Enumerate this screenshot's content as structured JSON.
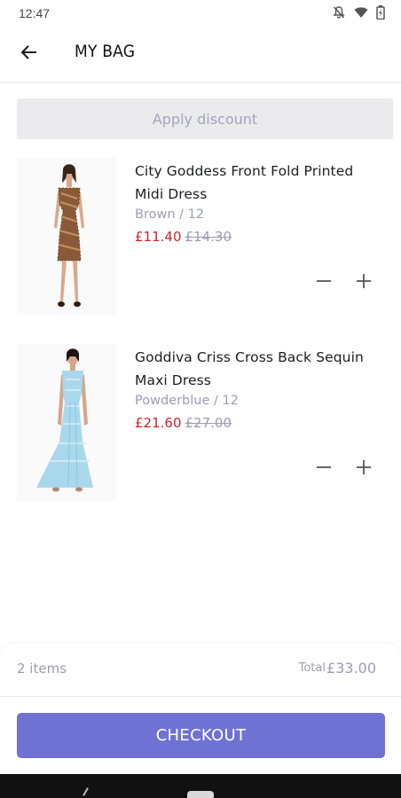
{
  "status_bar": {
    "time": "12:47",
    "icons": [
      "notifications-off-icon",
      "wifi-icon",
      "battery-icon"
    ]
  },
  "header": {
    "title": "MY BAG",
    "back_icon": "arrow-left-icon"
  },
  "discount": {
    "label": "Apply discount"
  },
  "cart": {
    "items": [
      {
        "name": "City Goddess Front Fold Printed Midi Dress",
        "variant": "Brown / 12",
        "price": "£11.40",
        "original_price": "£14.30",
        "image": "brown-printed-midi-dress-photo",
        "minus_icon": "minus-icon",
        "plus_icon": "plus-icon"
      },
      {
        "name": "Goddiva Criss Cross Back Sequin Maxi Dress",
        "variant": "Powderblue / 12",
        "price": "£21.60",
        "original_price": "£27.00",
        "image": "powderblue-sequin-maxi-dress-photo",
        "minus_icon": "minus-icon",
        "plus_icon": "plus-icon"
      }
    ]
  },
  "summary": {
    "items_count": "2 items",
    "total_label": "Total",
    "total_value": "£33.00"
  },
  "checkout": {
    "label": "CHECKOUT"
  },
  "colors": {
    "accent": "#6f72d3",
    "sale_price": "#d21f2b",
    "muted_text": "#9b9db4",
    "discount_bg": "#ebebee"
  }
}
